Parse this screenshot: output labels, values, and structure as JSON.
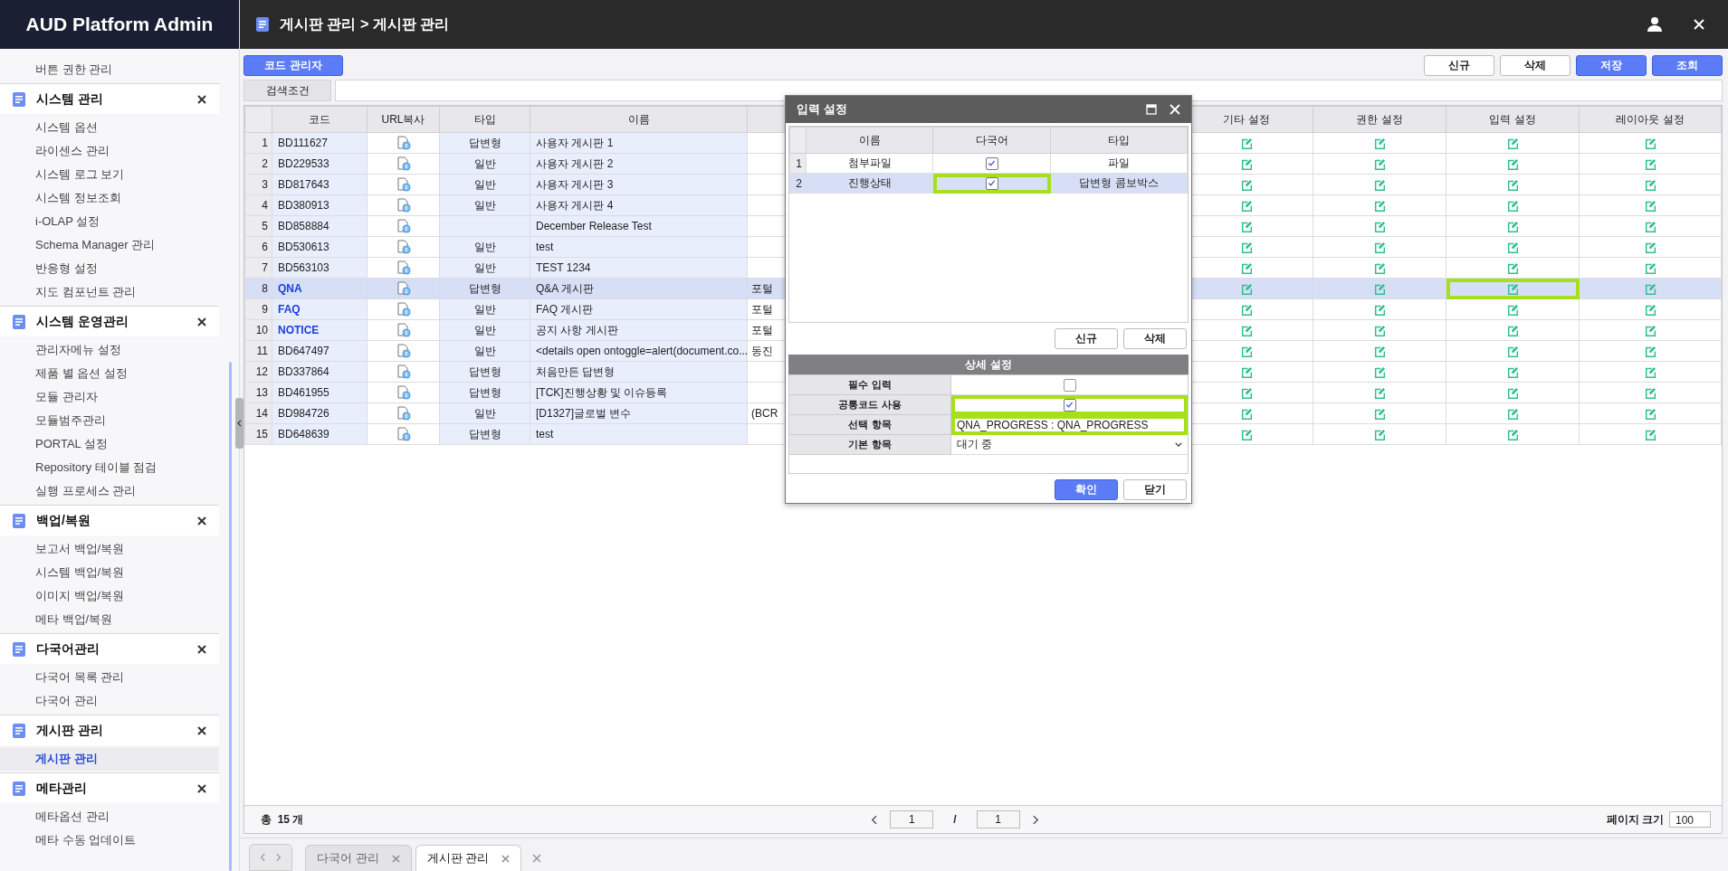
{
  "sidebar": {
    "title": "AUD Platform Admin",
    "groups": [
      {
        "items": [
          {
            "label": "버튼 권한 관리",
            "selected": false
          }
        ]
      },
      {
        "title": "시스템 관리",
        "items": [
          {
            "label": "시스템 옵션",
            "selected": false
          },
          {
            "label": "라이센스 관리",
            "selected": false
          },
          {
            "label": "시스템 로그 보기",
            "selected": false
          },
          {
            "label": "시스템 정보조회",
            "selected": false
          },
          {
            "label": "i-OLAP 설정",
            "selected": false
          },
          {
            "label": "Schema Manager 관리",
            "selected": false
          },
          {
            "label": "반응형 설정",
            "selected": false
          },
          {
            "label": "지도 컴포넌트 관리",
            "selected": false
          }
        ]
      },
      {
        "title": "시스템 운영관리",
        "items": [
          {
            "label": "관리자메뉴 설정",
            "selected": false
          },
          {
            "label": "제품 별 옵션 설정",
            "selected": false
          },
          {
            "label": "모듈 관리자",
            "selected": false
          },
          {
            "label": "모듈범주관리",
            "selected": false
          },
          {
            "label": "PORTAL 설정",
            "selected": false
          },
          {
            "label": "Repository 테이블 점검",
            "selected": false
          },
          {
            "label": "실행 프로세스 관리",
            "selected": false
          }
        ]
      },
      {
        "title": "백업/복원",
        "items": [
          {
            "label": "보고서 백업/복원",
            "selected": false
          },
          {
            "label": "시스템 백업/복원",
            "selected": false
          },
          {
            "label": "이미지 백업/복원",
            "selected": false
          },
          {
            "label": "메타 백업/복원",
            "selected": false
          }
        ]
      },
      {
        "title": "다국어관리",
        "items": [
          {
            "label": "다국어 목록 관리",
            "selected": false
          },
          {
            "label": "다국어 관리",
            "selected": false
          }
        ]
      },
      {
        "title": "게시판 관리",
        "items": [
          {
            "label": "게시판 관리",
            "selected": true
          }
        ]
      },
      {
        "title": "메타관리",
        "items": [
          {
            "label": "메타옵션 관리",
            "selected": false
          },
          {
            "label": "메타 수동 업데이트",
            "selected": false
          }
        ]
      }
    ]
  },
  "topbar": {
    "breadcrumb": "게시판 관리 > 게시판 관리"
  },
  "toolbar": {
    "left_button": "코드 관리자",
    "right_buttons": [
      {
        "label": "신규",
        "primary": false
      },
      {
        "label": "삭제",
        "primary": false
      },
      {
        "label": "저장",
        "primary": true
      },
      {
        "label": "조회",
        "primary": true
      }
    ]
  },
  "search": {
    "label": "검색조건"
  },
  "table": {
    "columns": [
      {
        "label": "코드",
        "kind": "code"
      },
      {
        "label": "URL복사",
        "kind": "link"
      },
      {
        "label": "타입",
        "kind": "type"
      },
      {
        "label": "이름",
        "kind": "name"
      },
      {
        "kind": "covered"
      },
      {
        "label": "기타 설정",
        "kind": "edit"
      },
      {
        "label": "권한 설정",
        "kind": "edit"
      },
      {
        "label": "입력 설정",
        "kind": "edit"
      },
      {
        "label": "레이아웃 설정",
        "kind": "edit"
      }
    ],
    "rows": [
      {
        "num": "1",
        "code": "BD111627",
        "builtin": false,
        "type": "답변형",
        "name": "사용자 게시판 1",
        "selected": false,
        "marked": false
      },
      {
        "num": "2",
        "code": "BD229533",
        "builtin": false,
        "type": "일반",
        "name": "사용자 게시판 2",
        "selected": false,
        "marked": false
      },
      {
        "num": "3",
        "code": "BD817643",
        "builtin": false,
        "type": "일반",
        "name": "사용자 게시판 3",
        "selected": false,
        "marked": false
      },
      {
        "num": "4",
        "code": "BD380913",
        "builtin": false,
        "type": "일반",
        "name": "사용자 게시판 4",
        "selected": false,
        "marked": false
      },
      {
        "num": "5",
        "code": "BD858884",
        "builtin": false,
        "name": "December Release Test",
        "selected": false,
        "marked": false
      },
      {
        "num": "6",
        "code": "BD530613",
        "builtin": false,
        "type": "일반",
        "name": "test",
        "selected": false,
        "marked": false
      },
      {
        "num": "7",
        "code": "BD563103",
        "builtin": false,
        "type": "일반",
        "name": "TEST 1234",
        "selected": false,
        "marked": false
      },
      {
        "num": "8",
        "code": "QNA",
        "builtin": true,
        "type": "답변형",
        "name": "Q&A 게시판",
        "column_5": "포털",
        "selected": true,
        "marked": true
      },
      {
        "num": "9",
        "code": "FAQ",
        "builtin": true,
        "type": "일반",
        "name": "FAQ 게시판",
        "column_5": "포털",
        "selected": false,
        "marked": false
      },
      {
        "num": "10",
        "code": "NOTICE",
        "builtin": true,
        "type": "일반",
        "name": "공지 사항 게시판",
        "column_5": "포털",
        "selected": false,
        "marked": false
      },
      {
        "num": "11",
        "code": "BD647497",
        "builtin": false,
        "type": "일반",
        "name": "<details open ontoggle=alert(document.co...",
        "column_5": "동진",
        "selected": false,
        "marked": false
      },
      {
        "num": "12",
        "code": "BD337864",
        "builtin": false,
        "type": "답변형",
        "name": "처음만든 답변형",
        "selected": false,
        "marked": false
      },
      {
        "num": "13",
        "code": "BD461955",
        "builtin": false,
        "type": "답변형",
        "name": "[TCK]진행상황 및 이슈등록",
        "selected": false,
        "marked": false
      },
      {
        "num": "14",
        "code": "BD984726",
        "builtin": false,
        "type": "일반",
        "name": "[D1327]글로벌 변수",
        "column_5": "(BCR",
        "selected": false,
        "marked": false
      },
      {
        "num": "15",
        "code": "BD648639",
        "builtin": false,
        "type": "답변형",
        "name": "test",
        "selected": false,
        "marked": false
      }
    ]
  },
  "footer": {
    "total_label": "총",
    "total": "15",
    "total_unit": "개",
    "page": "1",
    "separator": "/",
    "pages": "1",
    "page_size_label": "페이지 크기",
    "page_size": "100"
  },
  "tabs": [
    {
      "label": "다국어 관리",
      "selected": false
    },
    {
      "label": "게시판 관리",
      "selected": true
    }
  ],
  "dialog": {
    "title": "입력 설정",
    "grid": {
      "columns": [
        "이름",
        "다국어",
        "타입"
      ],
      "rows": [
        {
          "num": "1",
          "name": "첨부파일",
          "multilang": true,
          "type": "파일",
          "selected": false,
          "marked": false
        },
        {
          "num": "2",
          "name": "진행상태",
          "multilang": true,
          "type": "답변형 콤보박스",
          "selected": true,
          "marked": true
        }
      ]
    },
    "grid_buttons": [
      "신규",
      "삭제"
    ],
    "detail_title": "상세 설정",
    "details": [
      {
        "label": "필수 입력",
        "kind": "checkbox",
        "checked": false,
        "marked": false
      },
      {
        "label": "공통코드 사용",
        "kind": "checkbox",
        "checked": true,
        "marked": true
      },
      {
        "label": "선택 항목",
        "kind": "text",
        "value": "QNA_PROGRESS : QNA_PROGRESS",
        "marked": true
      },
      {
        "label": "기본 항목",
        "kind": "select",
        "value": "대기 중",
        "marked": false
      }
    ],
    "buttons": [
      {
        "label": "확인",
        "primary": true
      },
      {
        "label": "닫기",
        "primary": false
      }
    ]
  }
}
